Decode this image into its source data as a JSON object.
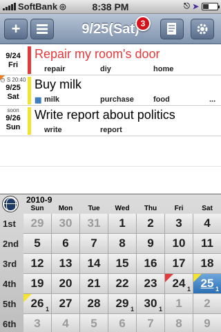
{
  "statusbar": {
    "carrier": "SoftBank",
    "time": "8:38 PM"
  },
  "toolbar": {
    "title": "9/25(Sat)",
    "badge": "3",
    "add_icon": "plus-icon",
    "list_icon": "list-icon",
    "note_icon": "notepad-icon",
    "settings_icon": "gear-icon"
  },
  "tasks": [
    {
      "date_line": "",
      "date": "9/24",
      "weekday": "Fri",
      "title": "Repair my room's door",
      "title_color": "#e23a3a",
      "bar_color": "#e23a3a",
      "tags": [
        "repair",
        "diy",
        "home"
      ]
    },
    {
      "date_line": "S 20:40",
      "date": "9/25",
      "weekday": "Sat",
      "title": "Buy milk",
      "title_color": "#000000",
      "bar_color": "#f4e332",
      "tags": [
        "milk",
        "purchase",
        "food",
        "..."
      ]
    },
    {
      "date_line": "soon",
      "date": "9/26",
      "weekday": "Sun",
      "title": "Write report about politics",
      "title_color": "#000000",
      "bar_color": "#f4e332",
      "tags": [
        "write",
        "report"
      ]
    }
  ],
  "calendar": {
    "month": "2010-9",
    "weekdays": [
      "Sun",
      "Mon",
      "Tue",
      "Wed",
      "Thu",
      "Fri",
      "Sat"
    ],
    "weeks": [
      "1st",
      "2nd",
      "3rd",
      "4th",
      "5th",
      "6th"
    ],
    "days": [
      [
        "29",
        "30",
        "31",
        "1",
        "2",
        "3",
        "4"
      ],
      [
        "5",
        "6",
        "7",
        "8",
        "9",
        "10",
        "11"
      ],
      [
        "12",
        "13",
        "14",
        "15",
        "16",
        "17",
        "18"
      ],
      [
        "19",
        "20",
        "21",
        "22",
        "23",
        "24",
        "25"
      ],
      [
        "26",
        "27",
        "28",
        "29",
        "30",
        "1",
        "2"
      ],
      [
        "3",
        "4",
        "5",
        "6",
        "7",
        "8",
        "9"
      ]
    ],
    "counts": {
      "3-5": "1",
      "3-6": "1",
      "4-0": "1",
      "4-3": "1",
      "4-4": "1"
    },
    "selected": "25",
    "colors": {
      "red": "#e23a3a",
      "yellow": "#f4e332",
      "selected": "#2a6fb5"
    }
  }
}
